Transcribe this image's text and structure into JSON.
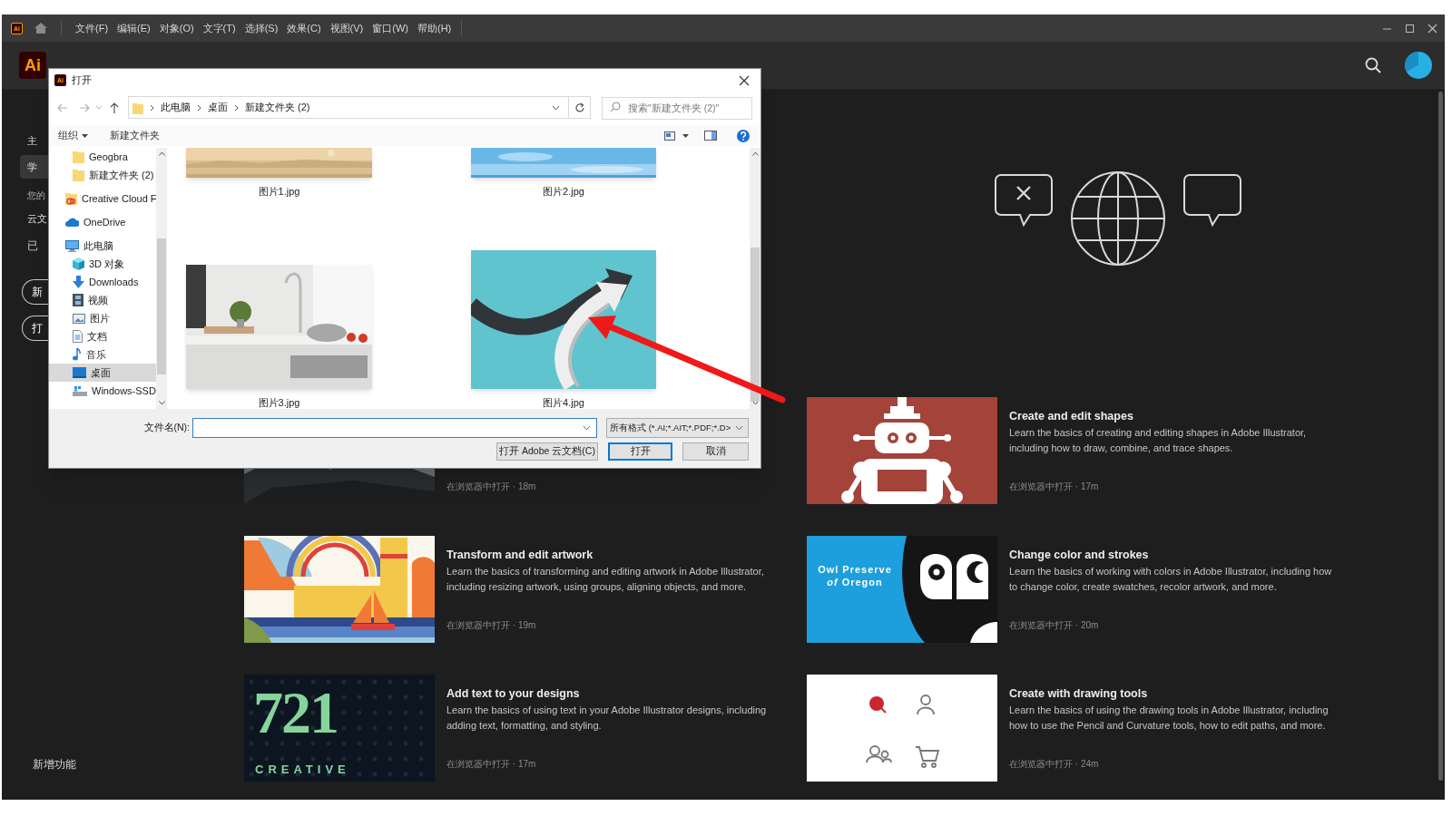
{
  "menu_bar": {
    "logo": "Ai",
    "items": [
      "文件(F)",
      "编辑(E)",
      "对象(O)",
      "文字(T)",
      "选择(S)",
      "效果(C)",
      "视图(V)",
      "窗口(W)",
      "帮助(H)"
    ]
  },
  "header": {
    "logo": "Ai"
  },
  "sidebar": {
    "items": [
      {
        "label": "主",
        "kind": "nav",
        "selected": false
      },
      {
        "label": "学",
        "kind": "nav",
        "selected": true
      },
      {
        "label": "您的",
        "kind": "section",
        "selected": false
      },
      {
        "label": "云文",
        "kind": "nav",
        "selected": false
      },
      {
        "label": "已",
        "kind": "subnav",
        "selected": false
      }
    ],
    "buttons": [
      "新",
      "打"
    ],
    "footer": "新增功能"
  },
  "cards": [
    {
      "meta": "在浏览器中打开 · 18m"
    },
    {
      "title": "Create and edit shapes",
      "description": "Learn the basics of creating and editing shapes in Adobe Illustrator, including how to draw, combine, and trace shapes.",
      "meta": "在浏览器中打开 · 17m"
    },
    {
      "title": "Transform and edit artwork",
      "description": "Learn the basics of transforming and editing artwork in Adobe Illustrator, including resizing artwork, using groups, aligning objects, and more.",
      "meta": "在浏览器中打开 · 19m"
    },
    {
      "title": "Change color and strokes",
      "description": "Learn the basics of working with colors in Adobe Illustrator, including how to change color, create swatches, recolor artwork, and more.",
      "meta": "在浏览器中打开 · 20m",
      "thumbnail_text": [
        "Owl Preserve",
        "*of* Oregon"
      ]
    },
    {
      "title": "Add text to your designs",
      "description": "Learn the basics of using text in your Adobe Illustrator designs, including adding text, formatting, and styling.",
      "meta": "在浏览器中打开 · 17m",
      "thumbnail_text": [
        "721",
        "CREATIVE"
      ]
    },
    {
      "title": "Create with drawing tools",
      "description": "Learn the basics of using the drawing tools in Adobe Illustrator, including how to use the Pencil and Curvature tools, how to edit paths, and more.",
      "meta": "在浏览器中打开 · 24m"
    }
  ],
  "open_dialog": {
    "icon": "Ai",
    "title": "打开",
    "breadcrumb": [
      "此电脑",
      "桌面",
      "新建文件夹 (2)"
    ],
    "search": {
      "placeholder": "搜索\"新建文件夹 (2)\""
    },
    "toolbar": [
      "组织",
      "新建文件夹"
    ],
    "nav_tree": [
      {
        "children": [
          {
            "label": "Geogbra",
            "kind": "folder",
            "selected": false
          },
          {
            "label": "新建文件夹 (2)",
            "kind": "folder",
            "selected": false
          }
        ]
      },
      {
        "label": "Creative Cloud F",
        "kind": "cloud-folder",
        "selected": false
      },
      {
        "label": "OneDrive",
        "kind": "onedrive",
        "selected": false
      },
      {
        "label": "此电脑",
        "kind": "computer",
        "selected": false,
        "children": [
          {
            "label": "3D 对象",
            "kind": "cube",
            "selected": false
          },
          {
            "label": "Downloads",
            "kind": "download",
            "selected": false
          },
          {
            "label": "视频",
            "kind": "video",
            "selected": false
          },
          {
            "label": "图片",
            "kind": "pictures",
            "selected": false
          },
          {
            "label": "文档",
            "kind": "documents",
            "selected": false
          },
          {
            "label": "音乐",
            "kind": "music",
            "selected": false
          },
          {
            "label": "桌面",
            "kind": "desktop",
            "selected": true
          },
          {
            "label": "Windows-SSD",
            "kind": "drive",
            "selected": false
          }
        ]
      }
    ],
    "files": [
      {
        "name": "图片1.jpg"
      },
      {
        "name": "图片2.jpg"
      },
      {
        "name": "图片3.jpg"
      },
      {
        "name": "图片4.jpg"
      }
    ],
    "filename_label": "文件名(N):",
    "file_type": "所有格式 (*.AI;*.AIT;*.PDF;*.D>",
    "buttons": [
      {
        "label": "打开 Adobe 云文档(C)",
        "default": false
      },
      {
        "label": "打开",
        "default": true
      },
      {
        "label": "取消",
        "default": false
      }
    ]
  }
}
